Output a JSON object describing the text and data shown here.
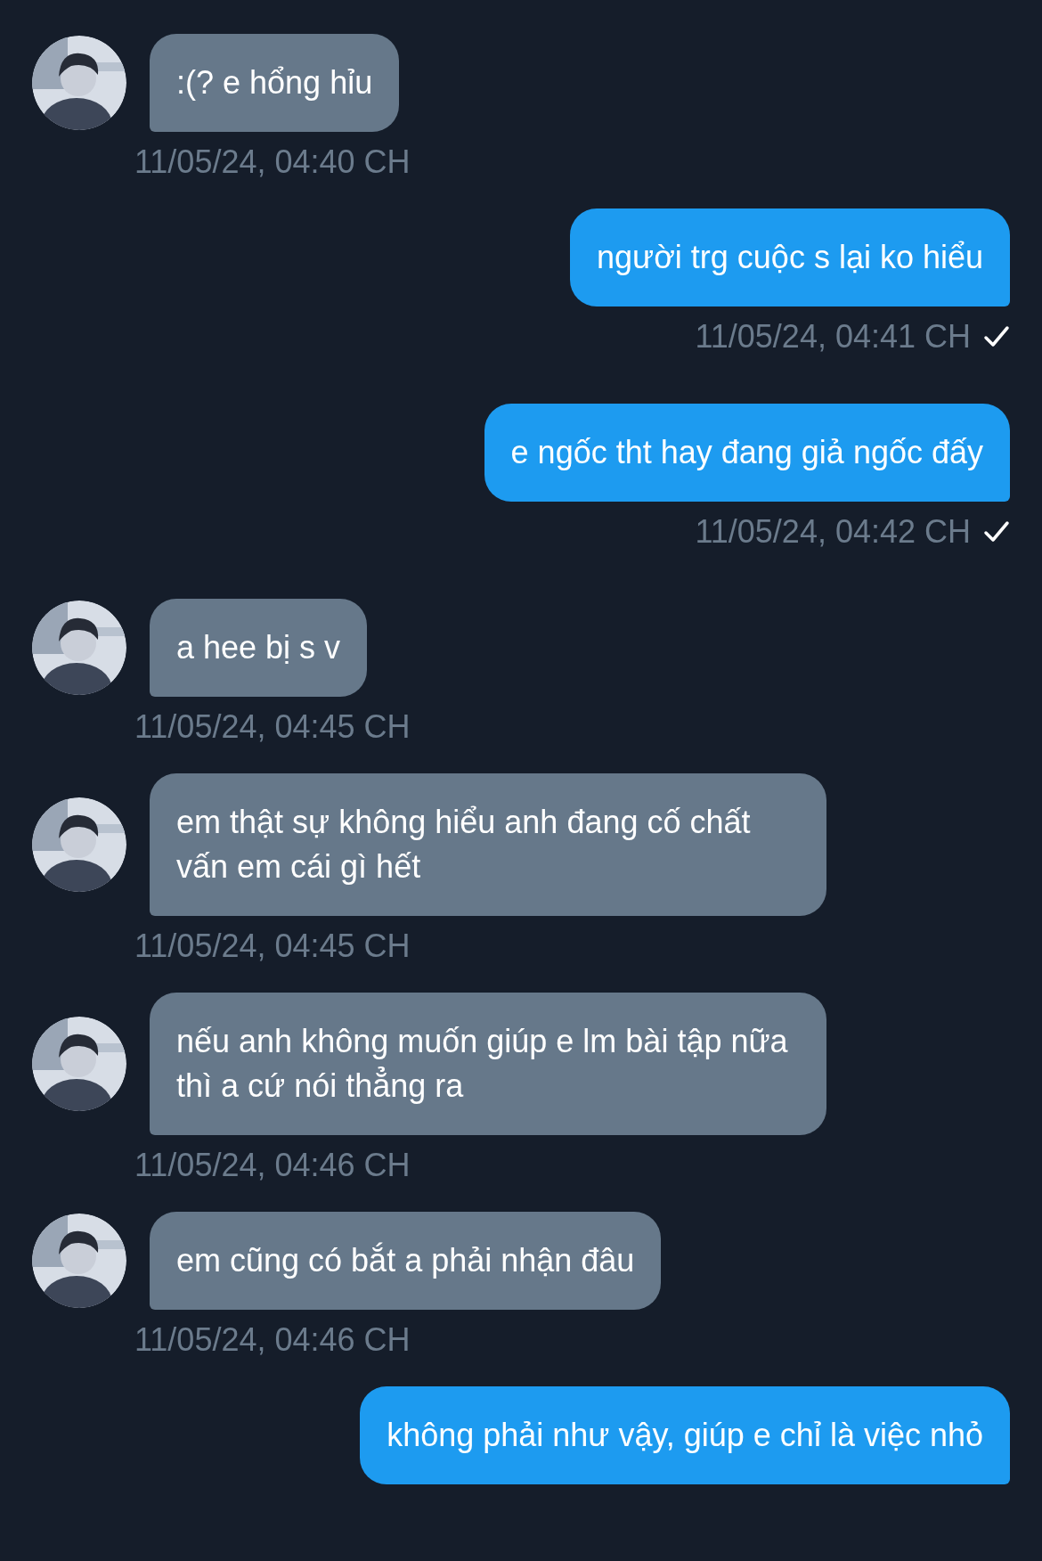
{
  "messages": [
    {
      "kind": "incoming",
      "text": ":(? e hổng hỉu",
      "time": "11/05/24, 04:40 CH"
    },
    {
      "kind": "outgoing",
      "text": "người trg cuộc s lại ko hiểu",
      "time": "11/05/24, 04:41 CH",
      "sent": true
    },
    {
      "kind": "outgoing",
      "text": "e ngốc tht hay đang giả ngốc đấy",
      "time": "11/05/24, 04:42 CH",
      "sent": true
    },
    {
      "kind": "incoming",
      "text": "a hee bị s v",
      "time": "11/05/24, 04:45 CH"
    },
    {
      "kind": "incoming",
      "text": "em thật sự không hiểu anh đang cố chất vấn em cái gì hết",
      "time": "11/05/24, 04:45 CH"
    },
    {
      "kind": "incoming",
      "text": "nếu anh không muốn giúp e lm bài tập nữa thì a cứ nói thẳng ra",
      "time": "11/05/24, 04:46 CH"
    },
    {
      "kind": "incoming",
      "text": "em cũng có bắt a phải nhận đâu",
      "time": "11/05/24, 04:46 CH"
    },
    {
      "kind": "outgoing",
      "text": "không phải như vậy, giúp e chỉ là việc nhỏ"
    }
  ]
}
